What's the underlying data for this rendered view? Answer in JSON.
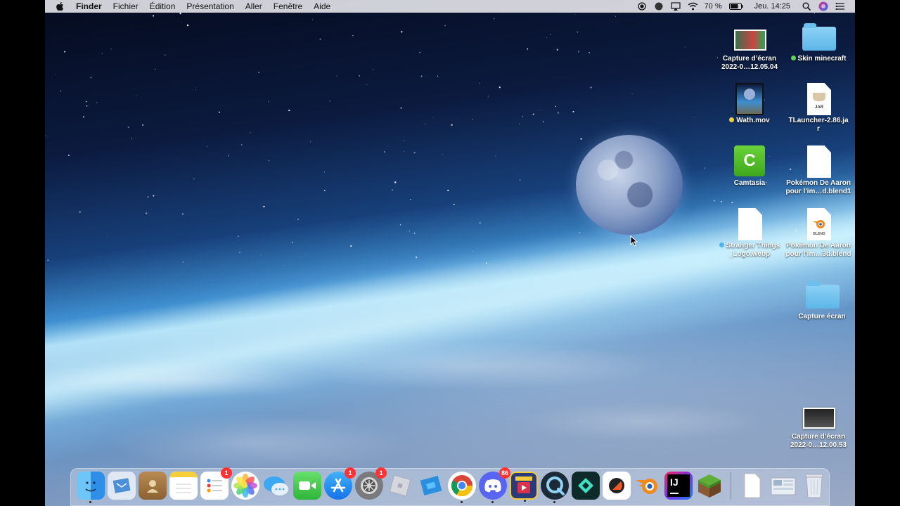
{
  "menubar": {
    "apple_icon": "apple-icon",
    "app_name": "Finder",
    "menus": [
      "Fichier",
      "Édition",
      "Présentation",
      "Aller",
      "Fenêtre",
      "Aide"
    ],
    "status": {
      "battery": "70 %",
      "clock": "Jeu. 14:25",
      "icons": [
        "record-icon",
        "circle-icon",
        "airplay-icon",
        "wifi-icon",
        "battery-icon",
        "search-icon",
        "siri-icon",
        "control-center-icon"
      ]
    }
  },
  "desktop_icons": [
    {
      "name": "Capture d’écran 2022-0…12.05.04",
      "line1": "Capture d’écran",
      "line2": "2022-0…12.05.04",
      "kind": "screenshot",
      "tag": null
    },
    {
      "name": "Skin minecraft",
      "line1": "Skin minecraft",
      "line2": "",
      "kind": "folder",
      "tag": "#5fd45a"
    },
    {
      "name": "Wath.mov",
      "line1": "Wath.mov",
      "line2": "",
      "kind": "movie",
      "tag": "#f2d23a"
    },
    {
      "name": "TLauncher-2.86.jar",
      "line1": "TLauncher-2.86.ja",
      "line2": "r",
      "kind": "jar",
      "tag": null
    },
    {
      "name": "Camtasia",
      "line1": "Camtasia",
      "line2": "",
      "kind": "app",
      "tag": null
    },
    {
      "name": "Pokémon De Aaron pour l'im…d.blend1",
      "line1": "Pokémon De Aaron",
      "line2": "pour l'im…d.blend1",
      "kind": "document",
      "tag": null
    },
    {
      "name": "Stranger Things _Logo.webp",
      "line1": "Stranger Things",
      "line2": "_Logo.webp",
      "kind": "document",
      "tag": "#4db2e8"
    },
    {
      "name": "Pokémon De Aaron pour l'im…3d.blend",
      "line1": "Pokémon De Aaron",
      "line2": "pour l'im…3d.blend",
      "kind": "blend",
      "tag": null
    },
    {
      "name": "Capture écran",
      "line1": "Capture écran",
      "line2": "",
      "kind": "folder",
      "tag": null
    },
    {
      "name": "Capture d’écran 2022-0…12.00.53",
      "line1": "Capture d’écran",
      "line2": "2022-0…12.00.53",
      "kind": "screenshot-dark",
      "tag": null
    }
  ],
  "dock": {
    "apps": [
      {
        "icon": "finder-icon",
        "badge": "",
        "running": true
      },
      {
        "icon": "mail-icon",
        "badge": "",
        "running": false
      },
      {
        "icon": "contacts-icon",
        "badge": "",
        "running": false
      },
      {
        "icon": "notes-icon",
        "badge": "",
        "running": false
      },
      {
        "icon": "reminders-icon",
        "badge": "1",
        "running": false
      },
      {
        "icon": "photos-icon",
        "badge": "",
        "running": false
      },
      {
        "icon": "messages-icon",
        "badge": "",
        "running": false
      },
      {
        "icon": "facetime-icon",
        "badge": "",
        "running": false
      },
      {
        "icon": "app-store-icon",
        "badge": "1",
        "running": false
      },
      {
        "icon": "system-preferences-icon",
        "badge": "1",
        "running": false
      },
      {
        "icon": "roblox-icon",
        "badge": "",
        "running": false
      },
      {
        "icon": "roblox-studio-icon",
        "badge": "",
        "running": false
      },
      {
        "icon": "chrome-icon",
        "badge": "",
        "running": true
      },
      {
        "icon": "discord-icon",
        "badge": "86",
        "running": true
      },
      {
        "icon": "pokemon-tv-icon",
        "badge": "",
        "running": true
      },
      {
        "icon": "quicktime-icon",
        "badge": "",
        "running": true
      },
      {
        "icon": "filmora-icon",
        "badge": "",
        "running": false
      },
      {
        "icon": "bezel-icon",
        "badge": "",
        "running": false
      },
      {
        "icon": "blender-icon",
        "badge": "",
        "running": false
      },
      {
        "icon": "intellij-icon",
        "badge": "",
        "running": false
      },
      {
        "icon": "minecraft-icon",
        "badge": "",
        "running": false
      }
    ],
    "others": [
      {
        "icon": "document-stack-icon"
      },
      {
        "icon": "downloads-stack-icon"
      },
      {
        "icon": "trash-icon"
      }
    ]
  }
}
